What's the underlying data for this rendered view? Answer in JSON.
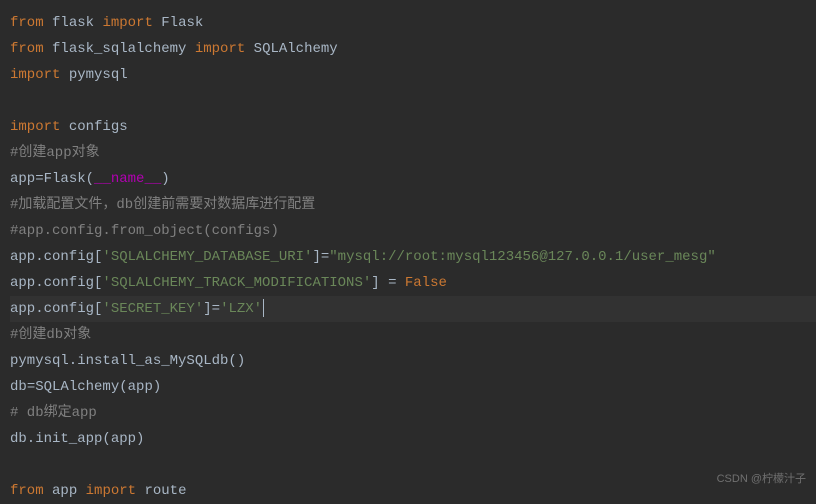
{
  "code": {
    "l1": {
      "from": "from",
      "m1": "flask",
      "imp": "import",
      "c1": "Flask"
    },
    "l2": {
      "from": "from",
      "m1": "flask_sqlalchemy",
      "imp": "import",
      "c1": "SQLAlchemy"
    },
    "l3": {
      "imp": "import",
      "m1": "pymysql"
    },
    "l5": {
      "imp": "import",
      "m1": "configs"
    },
    "l6": {
      "cmt": "#创建app对象"
    },
    "l7": {
      "a": "app",
      "eq": "=",
      "cls": "Flask",
      "lp": "(",
      "dun": "__name__",
      "rp": ")"
    },
    "l8": {
      "cmt": "#加载配置文件，db创建前需要对数据库进行配置"
    },
    "l9": {
      "cmt": "#app.config.from_object(configs)"
    },
    "l10": {
      "a": "app.config[",
      "s1": "'SQLALCHEMY_DATABASE_URI'",
      "b": "]=",
      "s2": "\"mysql://root:mysql123456@127.0.0.1/user_mesg\""
    },
    "l11": {
      "a": "app.config[",
      "s1": "'SQLALCHEMY_TRACK_MODIFICATIONS'",
      "b": "] = ",
      "f": "False"
    },
    "l12": {
      "a": "app.config[",
      "s1": "'SECRET_KEY'",
      "b": "]=",
      "s2": "'LZX'"
    },
    "l13": {
      "cmt": "#创建db对象"
    },
    "l14": {
      "a": "pymysql.install_as_MySQLdb()"
    },
    "l15": {
      "a": "db",
      "eq": "=",
      "cls": "SQLAlchemy",
      "lp": "(app)",
      "rp": ""
    },
    "l16": {
      "cmt": "# db绑定app"
    },
    "l17": {
      "a": "db.init_app(app)"
    },
    "l19": {
      "from": "from",
      "m1": "app",
      "imp": "import",
      "c1": "route"
    }
  },
  "watermark": "CSDN @柠檬汁子"
}
